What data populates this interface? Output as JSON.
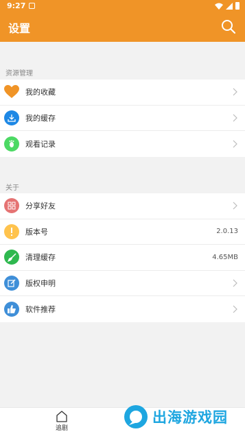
{
  "status_bar": {
    "time": "9:27"
  },
  "header": {
    "title": "设置",
    "search_icon": "search-icon",
    "background": "#f09427"
  },
  "sections": [
    {
      "label": "资源管理",
      "items": [
        {
          "label": "我的收藏",
          "icon": "heart-icon",
          "color": "#f09427",
          "value": "",
          "chevron": true
        },
        {
          "label": "我的缓存",
          "icon": "download-icon",
          "color": "#1e88e5",
          "value": "",
          "chevron": true
        },
        {
          "label": "观看记录",
          "icon": "footprint-icon",
          "color": "#4cd964",
          "value": "",
          "chevron": true
        }
      ]
    },
    {
      "label": "关于",
      "items": [
        {
          "label": "分享好友",
          "icon": "grid-icon",
          "color": "#e57373",
          "value": "",
          "chevron": true
        },
        {
          "label": "版本号",
          "icon": "exclamation-icon",
          "color": "#ffc34d",
          "value": "2.0.13",
          "chevron": false
        },
        {
          "label": "清理缓存",
          "icon": "broom-icon",
          "color": "#2fb84f",
          "value": "4.65MB",
          "chevron": false
        },
        {
          "label": "版权申明",
          "icon": "edit-icon",
          "color": "#3f8fd8",
          "value": "",
          "chevron": true
        },
        {
          "label": "软件推荐",
          "icon": "thumbs-up-icon",
          "color": "#3f8fd8",
          "value": "",
          "chevron": true
        }
      ]
    }
  ],
  "bottom_nav": {
    "home_label": "追剧",
    "home_icon": "home-icon"
  },
  "watermark": {
    "text": "出海游戏园"
  }
}
